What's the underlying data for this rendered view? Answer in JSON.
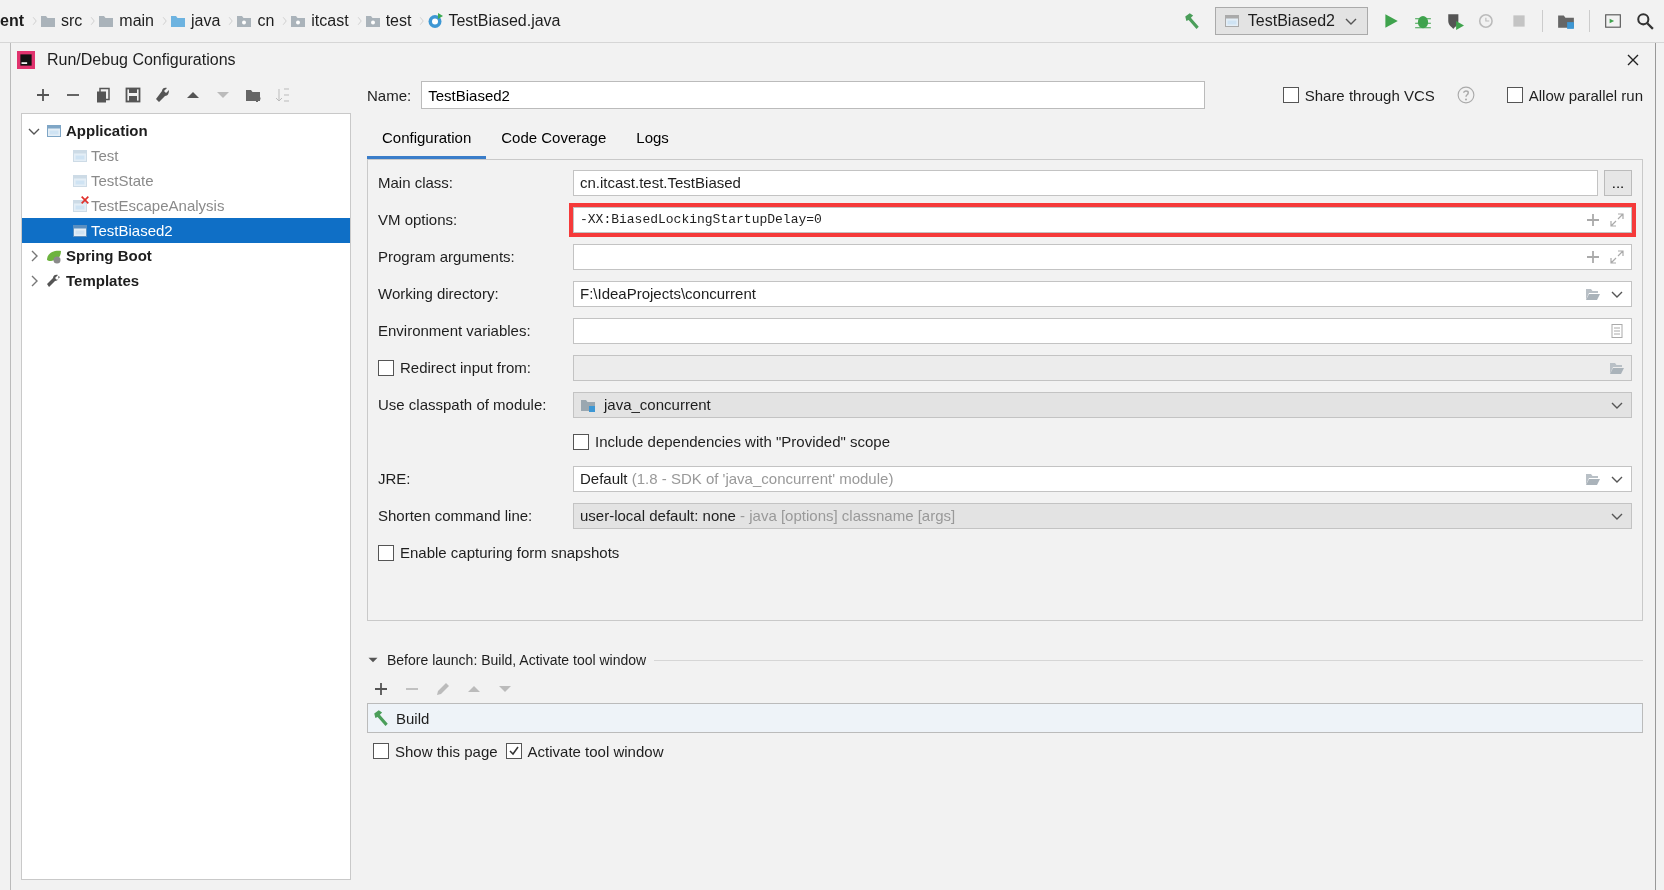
{
  "breadcrumbs": [
    {
      "label": "ent",
      "kind": "module"
    },
    {
      "label": "src",
      "kind": "folder"
    },
    {
      "label": "main",
      "kind": "folder"
    },
    {
      "label": "java",
      "kind": "source"
    },
    {
      "label": "cn",
      "kind": "package"
    },
    {
      "label": "itcast",
      "kind": "package"
    },
    {
      "label": "test",
      "kind": "package"
    },
    {
      "label": "TestBiased.java",
      "kind": "class"
    }
  ],
  "run_toolbar": {
    "configuration": "TestBiased2"
  },
  "dialog": {
    "title": "Run/Debug Configurations"
  },
  "tree": [
    {
      "label": "Application",
      "kind": "application",
      "expanded": true,
      "children": [
        {
          "label": "Test",
          "selected": false,
          "error": false
        },
        {
          "label": "TestState",
          "selected": false,
          "error": false
        },
        {
          "label": "TestEscapeAnalysis",
          "selected": false,
          "error": true
        },
        {
          "label": "TestBiased2",
          "selected": true,
          "error": false
        }
      ]
    },
    {
      "label": "Spring Boot",
      "kind": "spring",
      "expanded": false
    },
    {
      "label": "Templates",
      "kind": "templates",
      "expanded": false
    }
  ],
  "name": {
    "label": "Name:",
    "value": "TestBiased2"
  },
  "header_options": [
    {
      "kind": "checkbox",
      "label": "Share through VCS",
      "checked": false
    },
    {
      "kind": "help"
    },
    {
      "kind": "checkbox",
      "label": "Allow parallel run",
      "checked": false
    }
  ],
  "tabs": [
    {
      "label": "Configuration",
      "selected": true
    },
    {
      "label": "Code Coverage",
      "selected": false
    },
    {
      "label": "Logs",
      "selected": false
    }
  ],
  "fields": [
    {
      "kind": "text",
      "label": "Main class:",
      "value": "cn.itcast.test.TestBiased",
      "button": "...",
      "highlighted": false
    },
    {
      "kind": "expandable",
      "label": "VM options:",
      "value": "-XX:BiasedLockingStartupDelay=0",
      "highlighted": true
    },
    {
      "kind": "expandable",
      "label": "Program arguments:",
      "highlighted": false
    },
    {
      "kind": "path",
      "label": "Working directory:",
      "value": "F:\\IdeaProjects\\concurrent",
      "highlighted": false
    },
    {
      "kind": "env",
      "label": "Environment variables:",
      "highlighted": false
    },
    {
      "kind": "checkbox_path",
      "label": "Redirect input from:",
      "checked": false,
      "highlighted": false
    },
    {
      "kind": "module",
      "label": "Use classpath of module:",
      "value": "java_concurrent",
      "highlighted": false
    },
    {
      "kind": "option",
      "label": "Include dependencies with \"Provided\" scope",
      "checked": false,
      "highlighted": false
    },
    {
      "kind": "jre",
      "label": "JRE:",
      "value": "Default",
      "hint": "(1.8 - SDK of 'java_concurrent' module)",
      "highlighted": false
    },
    {
      "kind": "select",
      "label": "Shorten command line:",
      "value": "user-local default: none",
      "hint": "- java [options] classname [args]",
      "highlighted": false
    },
    {
      "kind": "checkbox",
      "label": "Enable capturing form snapshots",
      "checked": false,
      "highlighted": false
    }
  ],
  "before_launch": {
    "title": "Before launch: Build, Activate tool window",
    "expanded": true,
    "tasks": [
      {
        "label": "Build"
      }
    ]
  },
  "launch_options": [
    {
      "label": "Show this page",
      "checked": false
    },
    {
      "label": "Activate tool window",
      "checked": true
    }
  ]
}
